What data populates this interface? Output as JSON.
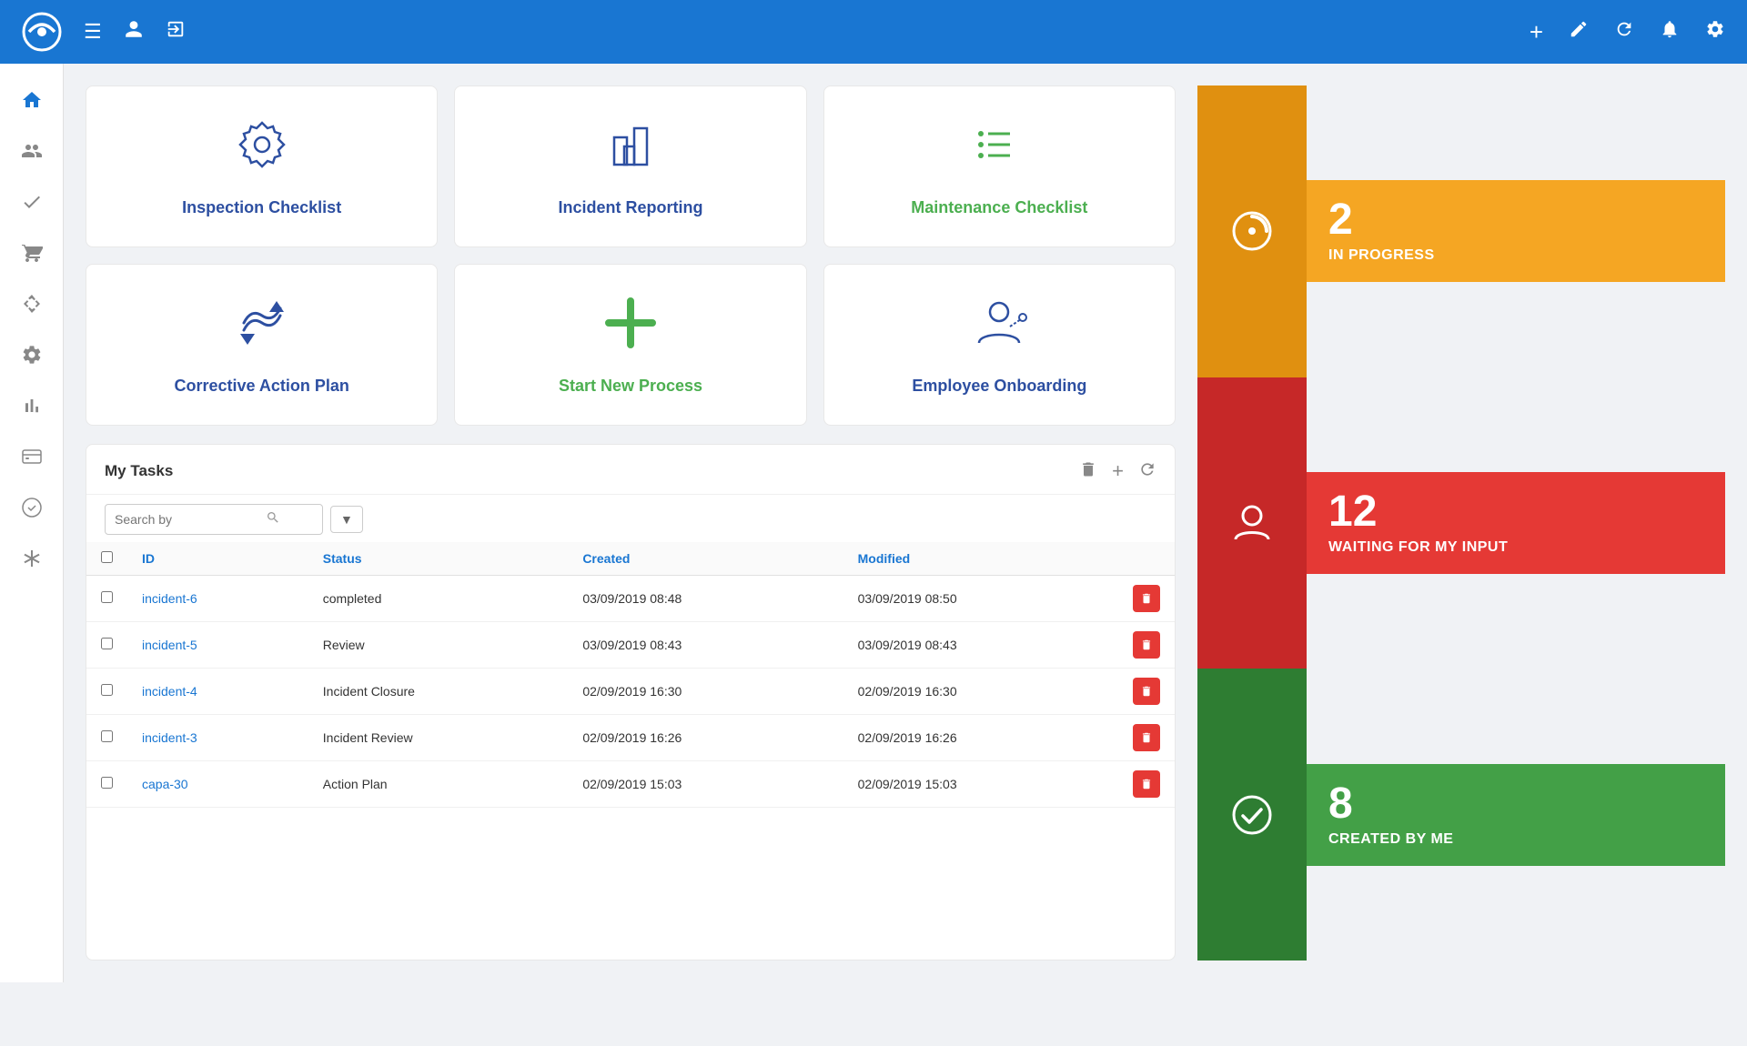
{
  "topNav": {
    "icons": [
      "menu",
      "user",
      "sign-out",
      "plus",
      "edit",
      "refresh",
      "bell",
      "settings"
    ]
  },
  "sidebar": {
    "items": [
      {
        "name": "home",
        "icon": "🏠",
        "active": true
      },
      {
        "name": "users",
        "icon": "👤",
        "active": false
      },
      {
        "name": "check",
        "icon": "✓",
        "active": false
      },
      {
        "name": "cart",
        "icon": "🛒",
        "active": false
      },
      {
        "name": "recycle",
        "icon": "♻",
        "active": false
      },
      {
        "name": "settings",
        "icon": "⚙",
        "active": false
      },
      {
        "name": "chart",
        "icon": "📊",
        "active": false
      },
      {
        "name": "dollar",
        "icon": "💲",
        "active": false
      },
      {
        "name": "check-circle",
        "icon": "✔",
        "active": false
      },
      {
        "name": "asterisk",
        "icon": "✱",
        "active": false
      }
    ]
  },
  "cards": [
    {
      "id": "inspection",
      "label": "Inspection Checklist",
      "color": "blue"
    },
    {
      "id": "incident",
      "label": "Incident Reporting",
      "color": "blue"
    },
    {
      "id": "maintenance",
      "label": "Maintenance Checklist",
      "color": "green"
    },
    {
      "id": "corrective",
      "label": "Corrective Action Plan",
      "color": "blue"
    },
    {
      "id": "new-process",
      "label": "Start New Process",
      "color": "green"
    },
    {
      "id": "onboarding",
      "label": "Employee Onboarding",
      "color": "blue"
    }
  ],
  "tasksPanel": {
    "title": "My Tasks",
    "searchPlaceholder": "Search by",
    "columns": [
      "ID",
      "Status",
      "Created",
      "Modified"
    ],
    "rows": [
      {
        "id": "incident-6",
        "status": "completed",
        "created": "03/09/2019 08:48",
        "modified": "03/09/2019 08:50"
      },
      {
        "id": "incident-5",
        "status": "Review",
        "created": "03/09/2019 08:43",
        "modified": "03/09/2019 08:43"
      },
      {
        "id": "incident-4",
        "status": "Incident Closure",
        "created": "02/09/2019 16:30",
        "modified": "02/09/2019 16:30"
      },
      {
        "id": "incident-3",
        "status": "Incident Review",
        "created": "02/09/2019 16:26",
        "modified": "02/09/2019 16:26"
      },
      {
        "id": "capa-30",
        "status": "Action Plan",
        "created": "02/09/2019 15:03",
        "modified": "02/09/2019 15:03"
      }
    ]
  },
  "stats": [
    {
      "number": "2",
      "label": "IN PROGRESS",
      "color": "orange"
    },
    {
      "number": "12",
      "label": "WAITING FOR MY INPUT",
      "color": "red"
    },
    {
      "number": "8",
      "label": "CREATED BY ME",
      "color": "green"
    }
  ]
}
